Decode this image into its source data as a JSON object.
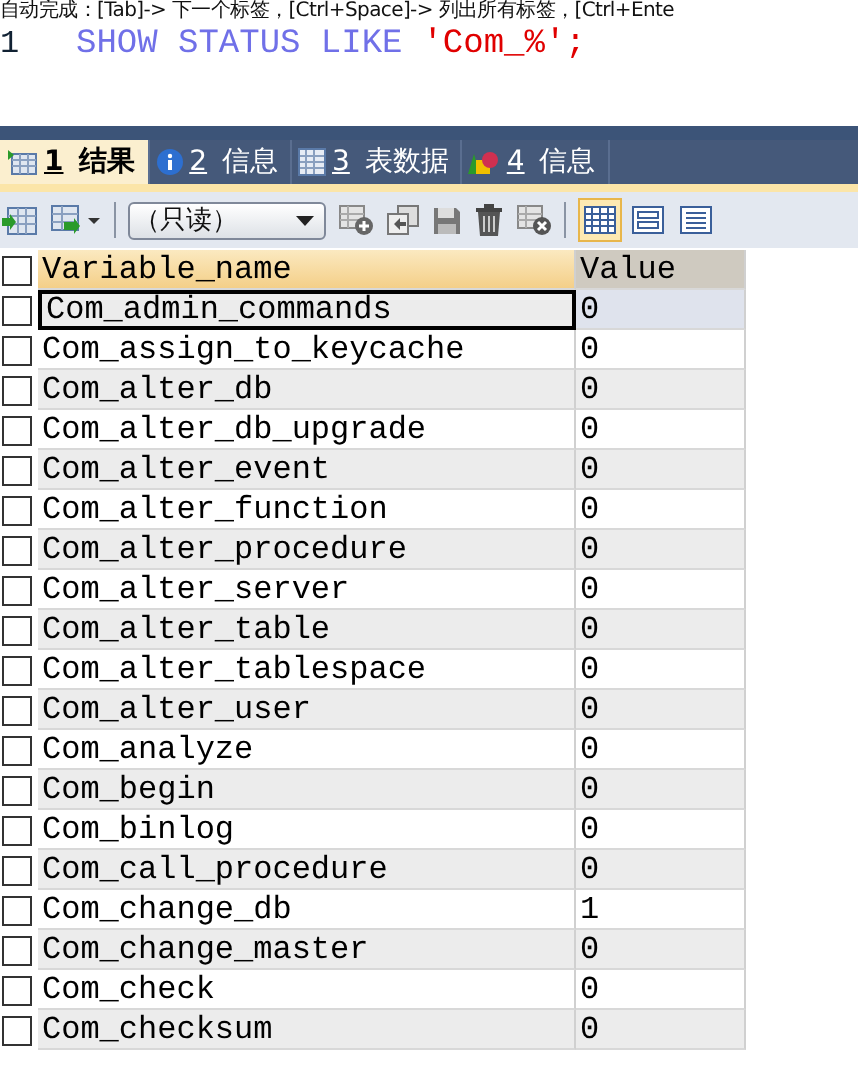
{
  "hint_bar": {
    "text": "自动完成：[Tab]-> 下一个标签，[Ctrl+Space]-> 列出所有标签，[Ctrl+Ente"
  },
  "editor": {
    "line_number": "1",
    "keywords": "SHOW STATUS LIKE",
    "string": "'Com_%'",
    "terminator": ";"
  },
  "tabs": [
    {
      "number": "1",
      "label": "结果",
      "kind": "grid",
      "selected": true
    },
    {
      "number": "2",
      "label": "信息",
      "kind": "info",
      "selected": false
    },
    {
      "number": "3",
      "label": "表数据",
      "kind": "table",
      "selected": false
    },
    {
      "number": "4",
      "label": "信息",
      "kind": "shapes",
      "selected": false
    }
  ],
  "toolbar": {
    "mode_dropdown": "（只读）",
    "view_modes": [
      {
        "kind": "grid",
        "selected": true
      },
      {
        "kind": "form",
        "selected": false
      },
      {
        "kind": "text",
        "selected": false
      }
    ]
  },
  "table": {
    "select_all_checked": false,
    "columns": [
      "Variable_name",
      "Value"
    ],
    "rows": [
      {
        "name": "Com_admin_commands",
        "value": "0",
        "selected": true,
        "checked": false
      },
      {
        "name": "Com_assign_to_keycache",
        "value": "0",
        "selected": false,
        "checked": false
      },
      {
        "name": "Com_alter_db",
        "value": "0",
        "selected": false,
        "checked": false
      },
      {
        "name": "Com_alter_db_upgrade",
        "value": "0",
        "selected": false,
        "checked": false
      },
      {
        "name": "Com_alter_event",
        "value": "0",
        "selected": false,
        "checked": false
      },
      {
        "name": "Com_alter_function",
        "value": "0",
        "selected": false,
        "checked": false
      },
      {
        "name": "Com_alter_procedure",
        "value": "0",
        "selected": false,
        "checked": false
      },
      {
        "name": "Com_alter_server",
        "value": "0",
        "selected": false,
        "checked": false
      },
      {
        "name": "Com_alter_table",
        "value": "0",
        "selected": false,
        "checked": false
      },
      {
        "name": "Com_alter_tablespace",
        "value": "0",
        "selected": false,
        "checked": false
      },
      {
        "name": "Com_alter_user",
        "value": "0",
        "selected": false,
        "checked": false
      },
      {
        "name": "Com_analyze",
        "value": "0",
        "selected": false,
        "checked": false
      },
      {
        "name": "Com_begin",
        "value": "0",
        "selected": false,
        "checked": false
      },
      {
        "name": "Com_binlog",
        "value": "0",
        "selected": false,
        "checked": false
      },
      {
        "name": "Com_call_procedure",
        "value": "0",
        "selected": false,
        "checked": false
      },
      {
        "name": "Com_change_db",
        "value": "1",
        "selected": false,
        "checked": false
      },
      {
        "name": "Com_change_master",
        "value": "0",
        "selected": false,
        "checked": false
      },
      {
        "name": "Com_check",
        "value": "0",
        "selected": false,
        "checked": false
      },
      {
        "name": "Com_checksum",
        "value": "0",
        "selected": false,
        "checked": false
      }
    ]
  }
}
